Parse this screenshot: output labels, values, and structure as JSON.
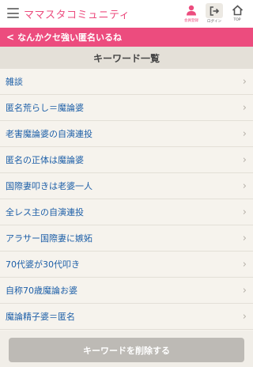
{
  "header": {
    "logo_text": "ママスタコミュニティ",
    "register_label": "会員登録",
    "login_label": "ログイン",
    "top_label": "TOP",
    "accent_color": "#ec4c7e"
  },
  "back_bar": {
    "label": "なんかクセ強い匿名いるね"
  },
  "section": {
    "title": "キーワード一覧"
  },
  "keywords": [
    "雑談",
    "匿名荒らし＝魔論婆",
    "老害魔論婆の自演連投",
    "匿名の正体は魔論婆",
    "国際妻叩きは老婆一人",
    "全レス主の自演連投",
    "アラサー国際妻に嫉妬",
    "70代婆が30代叩き",
    "自称70歳魔論お婆",
    "魔論精子婆＝匿名"
  ],
  "footer": {
    "delete_label": "キーワードを削除する"
  }
}
